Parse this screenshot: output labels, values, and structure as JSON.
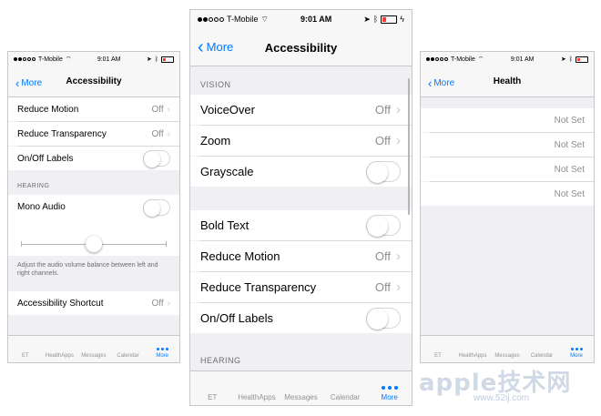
{
  "status": {
    "carrier": "T-Mobile",
    "time": "9:01 AM"
  },
  "left": {
    "back": "More",
    "title": "Accessibility",
    "rows": [
      {
        "label": "Reduce Motion",
        "value": "Off"
      },
      {
        "label": "Reduce Transparency",
        "value": "Off"
      },
      {
        "label": "On/Off Labels"
      }
    ],
    "hearing_header": "HEARING",
    "mono_audio": "Mono Audio",
    "footnote": "Adjust the audio volume balance between left and right channels.",
    "shortcut": {
      "label": "Accessibility Shortcut",
      "value": "Off"
    },
    "balance": 0.5
  },
  "center": {
    "back": "More",
    "title": "Accessibility",
    "vision_header": "VISION",
    "rows_a": [
      {
        "label": "VoiceOver",
        "value": "Off"
      },
      {
        "label": "Zoom",
        "value": "Off"
      },
      {
        "label": "Grayscale"
      }
    ],
    "rows_b": [
      {
        "label": "Bold Text"
      },
      {
        "label": "Reduce Motion",
        "value": "Off"
      },
      {
        "label": "Reduce Transparency",
        "value": "Off"
      },
      {
        "label": "On/Off Labels"
      }
    ],
    "hearing_header": "HEARING"
  },
  "right": {
    "back": "More",
    "title": "Health",
    "rows": [
      "Not Set",
      "Not Set",
      "Not Set",
      "Not Set"
    ]
  },
  "tabs": [
    "ET",
    "HealthApps",
    "Messages",
    "Calendar",
    "More"
  ],
  "watermark": "apple技术网",
  "watermark_url": "www.52ij.com",
  "colors": {
    "accent": "#007aff",
    "background": "#efeff4"
  }
}
